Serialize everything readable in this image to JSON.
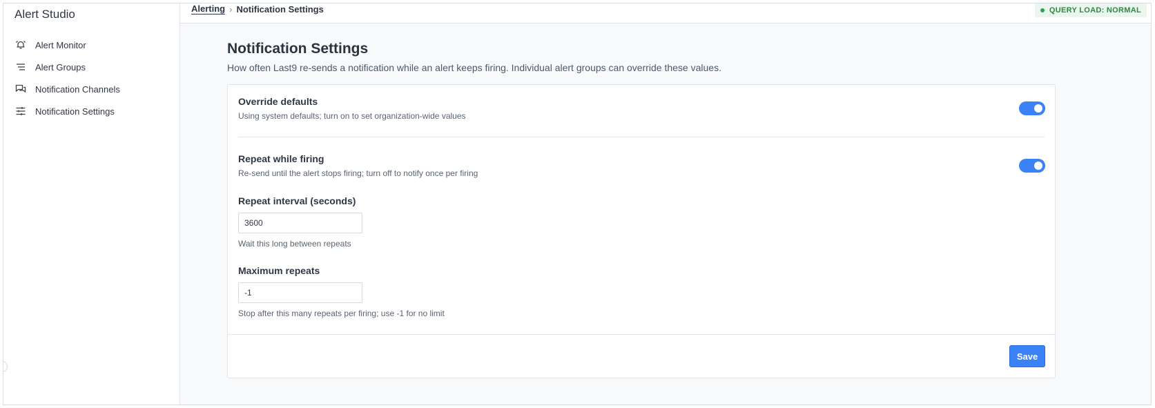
{
  "app": {
    "title": "Alert Studio"
  },
  "sidebar": {
    "items": [
      {
        "label": "Alert Monitor",
        "icon": "alarm-bell-icon"
      },
      {
        "label": "Alert Groups",
        "icon": "list-icon"
      },
      {
        "label": "Notification Channels",
        "icon": "chat-bubbles-icon"
      },
      {
        "label": "Notification Settings",
        "icon": "sliders-icon"
      }
    ]
  },
  "header": {
    "breadcrumb": {
      "parent": "Alerting",
      "separator": "›",
      "current": "Notification Settings"
    },
    "status": {
      "label": "QUERY LOAD: NORMAL",
      "color": "#2a8a3e"
    }
  },
  "main": {
    "title": "Notification Settings",
    "description": "How often Last9 re-sends a notification while an alert keeps firing. Individual alert groups can override these values."
  },
  "settings": {
    "override": {
      "title": "Override defaults",
      "subtitle": "Using system defaults; turn on to set organization-wide values",
      "enabled": true
    },
    "repeat": {
      "title": "Repeat while firing",
      "subtitle": "Re-send until the alert stops firing; turn off to notify once per firing",
      "enabled": true
    },
    "interval": {
      "label": "Repeat interval (seconds)",
      "value": "3600",
      "help": "Wait this long between repeats"
    },
    "max_repeats": {
      "label": "Maximum repeats",
      "value": "-1",
      "help": "Stop after this many repeats per firing; use -1 for no limit"
    },
    "save_label": "Save"
  },
  "colors": {
    "accent": "#3b82f6",
    "status_bg": "#eaf6ee"
  }
}
